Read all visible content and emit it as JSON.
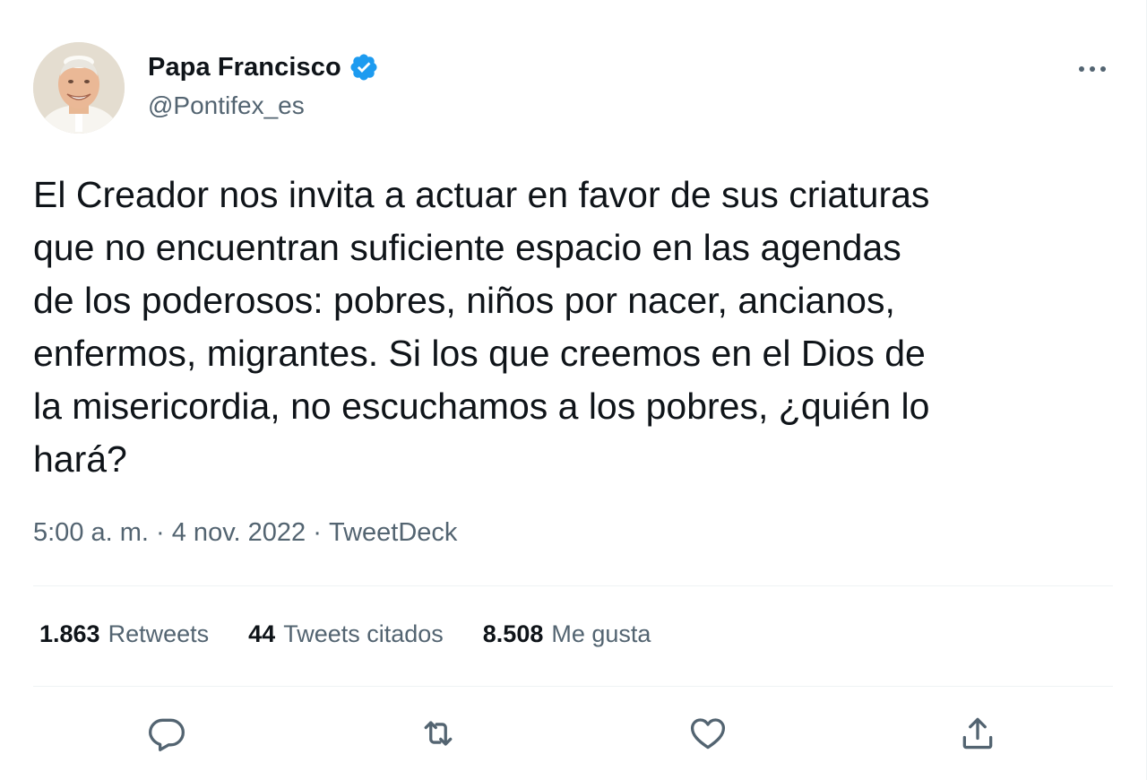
{
  "author": {
    "display_name": "Papa Francisco",
    "handle": "@Pontifex_es",
    "verified": true,
    "verified_color": "#1d9bf0",
    "avatar_icon": "avatar-photo"
  },
  "more_icon": "more-horizontal-icon",
  "tweet": {
    "text": "El Creador nos invita a actuar en favor de sus criaturas\nque no encuentran suficiente espacio en las agendas\nde los poderosos: pobres, niños por nacer, ancianos,\nenfermos, migrantes. Si los que creemos en el Dios de\nla misericordia, no escuchamos a los pobres, ¿quién lo\nhará?"
  },
  "meta": {
    "time": "5:00 a. m.",
    "separator1": " · ",
    "date": "4 nov. 2022",
    "separator2": " · ",
    "source": "TweetDeck"
  },
  "stats": {
    "retweets_count": "1.863",
    "retweets_label": "Retweets",
    "quotes_count": "44",
    "quotes_label": "Tweets citados",
    "likes_count": "8.508",
    "likes_label": "Me gusta"
  },
  "actions": [
    {
      "name": "reply",
      "icon": "reply-icon"
    },
    {
      "name": "retweet",
      "icon": "retweet-icon"
    },
    {
      "name": "like",
      "icon": "heart-icon"
    },
    {
      "name": "share",
      "icon": "share-icon"
    }
  ],
  "colors": {
    "text_primary": "#0f1419",
    "text_secondary": "#536471",
    "divider": "#eff3f4",
    "accent": "#1d9bf0"
  }
}
